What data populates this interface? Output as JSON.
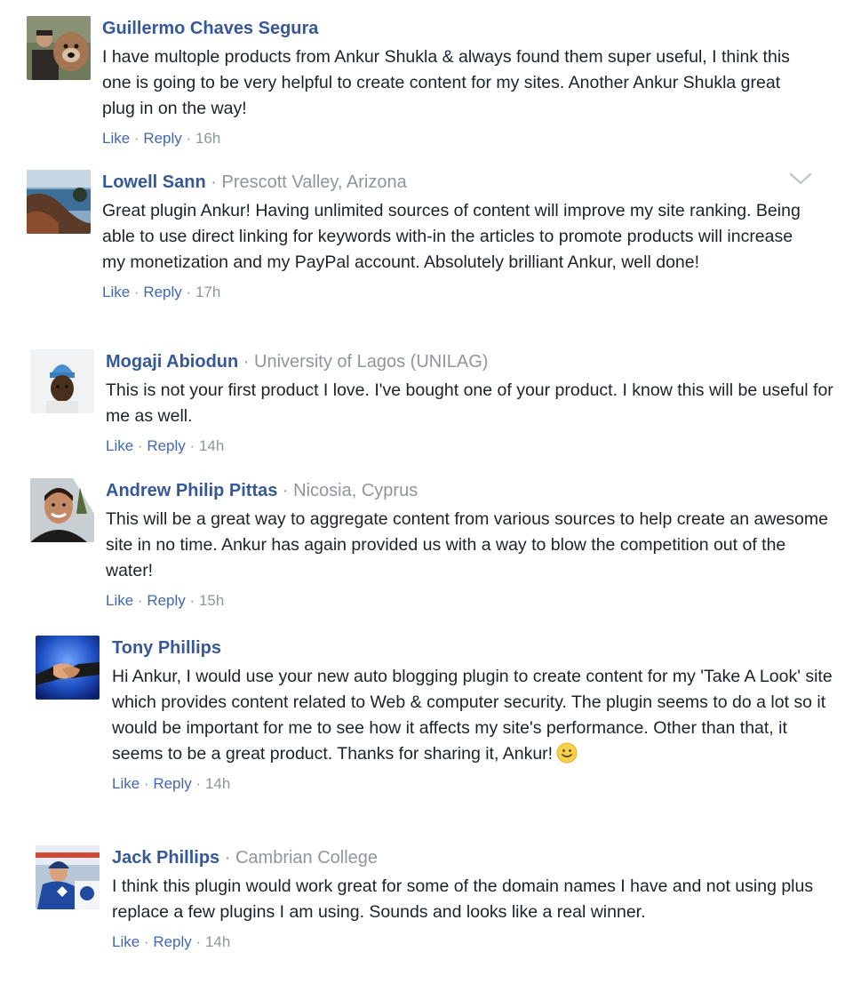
{
  "comments": [
    {
      "name": "Guillermo Chaves Segura",
      "location": "",
      "text": "I have multople products from Ankur Shukla & always found them super useful, I think this one is going to be very helpful to create content for my sites. Another Ankur Shukla great plug in on the way!",
      "like": "Like",
      "reply": "Reply",
      "time": "16h",
      "avatar_icon": "man-with-dog-avatar"
    },
    {
      "name": "Lowell Sann",
      "location": "Prescott Valley, Arizona",
      "text": "Great plugin Ankur! Having unlimited sources of content will improve my site ranking. Being able to use direct linking for keywords with-in the articles to promote products will increase my monetization and my PayPal account. Absolutely brilliant Ankur, well done!",
      "like": "Like",
      "reply": "Reply",
      "time": "17h",
      "avatar_icon": "lake-landscape-avatar"
    },
    {
      "name": "Mogaji Abiodun",
      "location": "University of Lagos (UNILAG)",
      "text": "This is not your first product I love. I've bought one of your product. I know this will be useful for me as well.",
      "like": "Like",
      "reply": "Reply",
      "time": "14h",
      "avatar_icon": "man-in-blue-cap-avatar"
    },
    {
      "name": "Andrew Philip Pittas",
      "location": "Nicosia, Cyprus",
      "text": "This will be a great way to aggregate content from various sources to help create an awesome site in no time. Ankur has again provided us with a way to blow the competition out of the water!",
      "like": "Like",
      "reply": "Reply",
      "time": "15h",
      "avatar_icon": "smiling-man-avatar"
    },
    {
      "name": "Tony Phillips",
      "location": "",
      "text": "Hi Ankur, I would use your new auto blogging plugin to create content for my 'Take A Look' site which provides content related to Web & computer security. The plugin seems to do a lot so it would be important for me to see how it affects my site's performance. Other than that, it seems to be a great product. Thanks for sharing it, Ankur!",
      "like": "Like",
      "reply": "Reply",
      "time": "14h",
      "avatar_icon": "handshake-avatar",
      "emoji": "slight-smile-emoji"
    },
    {
      "name": "Jack Phillips",
      "location": "Cambrian College",
      "text": "I think this plugin would work great for some of the domain names I have and not using plus replace a few plugins I am using. Sounds and looks like a real winner.",
      "like": "Like",
      "reply": "Reply",
      "time": "14h",
      "avatar_icon": "hockey-fan-avatar"
    }
  ],
  "ui": {
    "separator": "·",
    "options_icon": "chevron-down-icon"
  },
  "colors": {
    "name": "#365899",
    "link": "#4267b2",
    "meta": "#90949c",
    "text": "#1d2129"
  }
}
